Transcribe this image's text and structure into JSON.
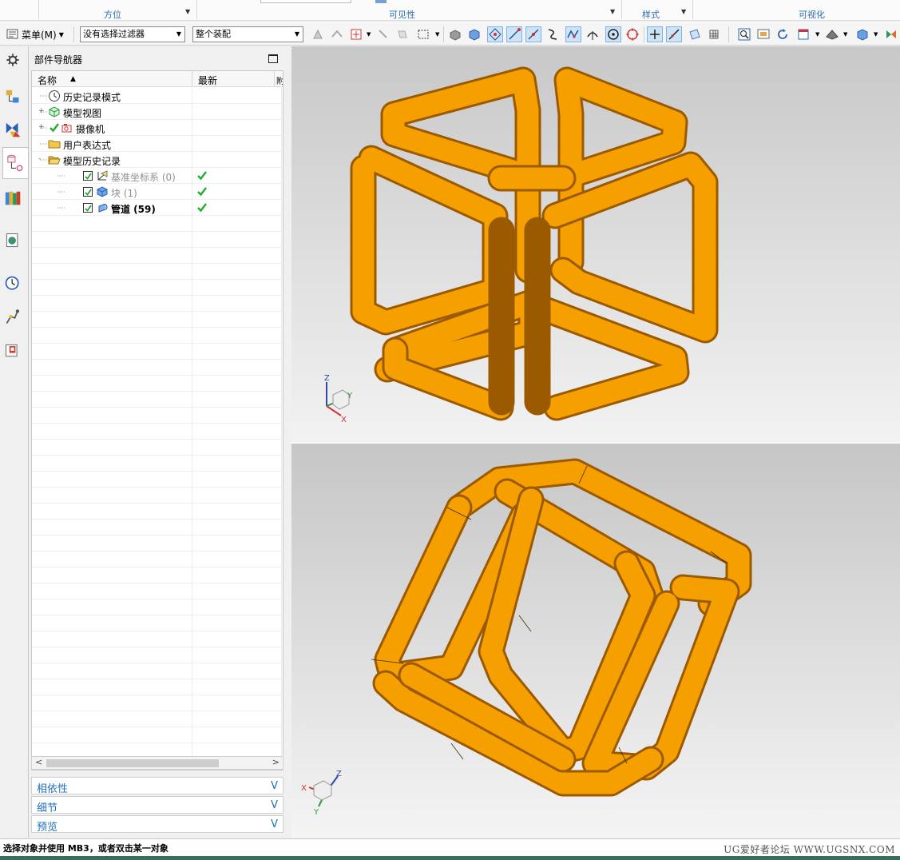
{
  "ribbon_groups": [
    {
      "label": "方位",
      "has_dropdown": true
    },
    {
      "label": "可见性",
      "has_dropdown": true
    },
    {
      "label": "样式",
      "has_dropdown": true
    },
    {
      "label": "可视化",
      "has_dropdown": false
    }
  ],
  "toolbar": {
    "menu_label": "菜单(M)",
    "selection_filter": "没有选择过滤器",
    "assembly_scope": "整个装配"
  },
  "navigator": {
    "title": "部件导航器",
    "columns": [
      "名称",
      "最新",
      "附"
    ],
    "rows": [
      {
        "label": "历史记录模式",
        "icon": "clock-icon",
        "level": 0,
        "expander": "",
        "checked": null,
        "latest": false,
        "style": "normal"
      },
      {
        "label": "模型视图",
        "icon": "model-view-icon",
        "level": 0,
        "expander": "+",
        "checked": null,
        "latest": false,
        "style": "normal"
      },
      {
        "label": "摄像机",
        "icon": "camera-icon",
        "level": 0,
        "expander": "+",
        "checked": "check-only",
        "latest": false,
        "style": "normal"
      },
      {
        "label": "用户表达式",
        "icon": "folder-icon",
        "level": 0,
        "expander": "",
        "checked": null,
        "latest": false,
        "style": "normal"
      },
      {
        "label": "模型历史记录",
        "icon": "folder-open-icon",
        "level": 0,
        "expander": "-",
        "checked": null,
        "latest": false,
        "style": "normal"
      },
      {
        "label": "基准坐标系 (0)",
        "icon": "datum-csys-icon",
        "level": 1,
        "expander": "",
        "checked": "box",
        "latest": true,
        "style": "dim"
      },
      {
        "label": "块 (1)",
        "icon": "block-icon",
        "level": 1,
        "expander": "",
        "checked": "box",
        "latest": true,
        "style": "dim"
      },
      {
        "label": "管道 (59)",
        "icon": "tube-icon",
        "level": 1,
        "expander": "",
        "checked": "box",
        "latest": true,
        "style": "bold"
      }
    ]
  },
  "panels": [
    {
      "label": "相依性"
    },
    {
      "label": "细节"
    },
    {
      "label": "预览"
    }
  ],
  "status": {
    "prompt": "选择对象并使用 MB3，或者双击某一对象",
    "watermark": "UG爱好者论坛 WWW.UGSNX.COM"
  },
  "colors": {
    "accent": "#1f6fbf",
    "model_orange": "#f5a000",
    "tick_green": "#1fae2c",
    "toolbar_highlight": "#cde4f7"
  }
}
